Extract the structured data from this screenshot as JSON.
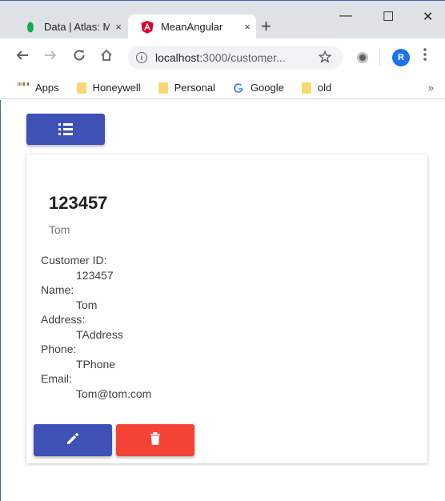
{
  "browser": {
    "tabs": [
      {
        "title": "Data | Atlas: M",
        "icon": "leaf-icon",
        "active": false
      },
      {
        "title": "MeanAngular",
        "icon": "angular-icon",
        "active": true
      }
    ],
    "new_tab": "+",
    "close_glyph": "×",
    "window_controls": {
      "minimize": "—",
      "maximize": "☐",
      "close": "✕"
    },
    "address": {
      "host": "localhost",
      "path": ":3000/customer..."
    },
    "avatar_letter": "R",
    "bookmarks": [
      {
        "label": "Apps",
        "icon": "apps-grid-icon"
      },
      {
        "label": "Honeywell",
        "icon": "folder-icon"
      },
      {
        "label": "Personal",
        "icon": "folder-icon"
      },
      {
        "label": "Google",
        "icon": "google-icon"
      },
      {
        "label": "old",
        "icon": "folder-icon"
      }
    ],
    "bookmarks_more": "»"
  },
  "card": {
    "title": "123457",
    "subtitle": "Tom",
    "fields": [
      {
        "label": "Customer ID:",
        "value": "123457"
      },
      {
        "label": "Name:",
        "value": "Tom"
      },
      {
        "label": "Address:",
        "value": "TAddress"
      },
      {
        "label": "Phone:",
        "value": "TPhone"
      },
      {
        "label": "Email:",
        "value": "Tom@tom.com"
      }
    ]
  },
  "colors": {
    "primary": "#3f51b5",
    "warn": "#f44336"
  }
}
